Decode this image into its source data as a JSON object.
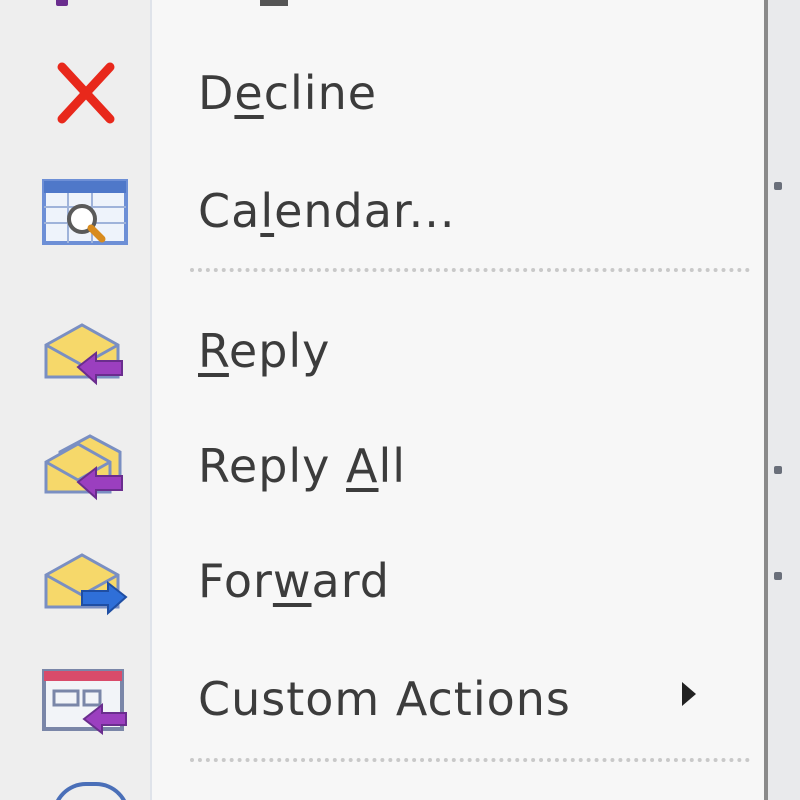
{
  "menu": {
    "items": [
      {
        "id": "decline",
        "label_pre": "D",
        "label_u": "e",
        "label_post": "cline",
        "icon": "decline-x-icon",
        "submenu": false
      },
      {
        "id": "calendar",
        "label_pre": "Ca",
        "label_u": "l",
        "label_post": "endar...",
        "icon": "calendar-icon",
        "submenu": false
      },
      {
        "id": "reply",
        "label_pre": "",
        "label_u": "R",
        "label_post": "eply",
        "icon": "reply-icon",
        "submenu": false
      },
      {
        "id": "reply-all",
        "label_pre": "Reply ",
        "label_u": "A",
        "label_post": "ll",
        "icon": "reply-all-icon",
        "submenu": false
      },
      {
        "id": "forward",
        "label_pre": "For",
        "label_u": "w",
        "label_post": "ard",
        "icon": "forward-icon",
        "submenu": false
      },
      {
        "id": "custom-actions",
        "label_pre": "Custom Actions",
        "label_u": "",
        "label_post": "",
        "icon": "custom-actions-icon",
        "submenu": true
      }
    ]
  },
  "colors": {
    "decline": "#e8281b",
    "envelope_yellow": "#f6d86a",
    "envelope_blue": "#6d8fd6",
    "arrow_purple": "#9b3fbf",
    "arrow_blue": "#2f6fd8"
  }
}
